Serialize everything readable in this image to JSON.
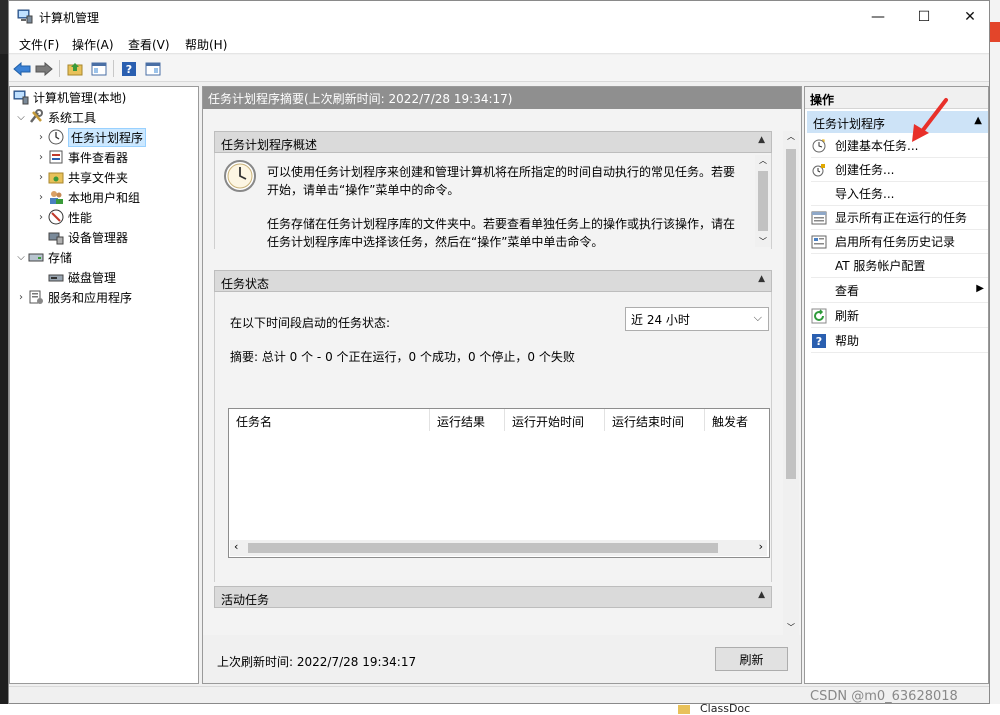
{
  "window": {
    "title": "计算机管理",
    "minimize": "—",
    "maximize": "☐",
    "close": "✕"
  },
  "menu": {
    "file": "文件(F)",
    "action": "操作(A)",
    "view": "查看(V)",
    "help": "帮助(H)"
  },
  "tree": {
    "root": "计算机管理(本地)",
    "system_tools": "系统工具",
    "task_scheduler": "任务计划程序",
    "event_viewer": "事件查看器",
    "shared_folders": "共享文件夹",
    "local_users": "本地用户和组",
    "performance": "性能",
    "device_manager": "设备管理器",
    "storage": "存储",
    "disk_management": "磁盘管理",
    "services_apps": "服务和应用程序"
  },
  "center": {
    "header": "任务计划程序摘要(上次刷新时间: 2022/7/28 19:34:17)",
    "overview": {
      "title": "任务计划程序概述",
      "p1_line1": "可以使用任务计划程序来创建和管理计算机将在所指定的时间自动执行的常见任务。若要",
      "p1_line2": "开始，请单击“操作”菜单中的命令。",
      "p2_line1": "任务存储在任务计划程序库的文件夹中。若要查看单独任务上的操作或执行该操作，请在",
      "p2_line2": "任务计划程序库中选择该任务，然后在“操作”菜单中单击命令。"
    },
    "status": {
      "title": "任务状态",
      "period_label": "在以下时间段启动的任务状态:",
      "period_value": "近 24 小时",
      "summary": "摘要: 总计 0 个 - 0 个正在运行，0 个成功，0 个停止，0 个失败",
      "columns": [
        "任务名",
        "运行结果",
        "运行开始时间",
        "运行结束时间",
        "触发者"
      ]
    },
    "active": {
      "title": "活动任务"
    },
    "footer": {
      "last_refresh": "上次刷新时间: 2022/7/28 19:34:17",
      "refresh_button": "刷新"
    }
  },
  "actions": {
    "header": "操作",
    "section": "任务计划程序",
    "items": [
      {
        "label": "创建基本任务...",
        "icon": "basic-task-icon"
      },
      {
        "label": "创建任务...",
        "icon": "create-task-icon"
      },
      {
        "label": "导入任务...",
        "icon": ""
      },
      {
        "label": "显示所有正在运行的任务",
        "icon": "running-tasks-icon"
      },
      {
        "label": "启用所有任务历史记录",
        "icon": "history-icon"
      },
      {
        "label": "AT 服务帐户配置",
        "icon": ""
      },
      {
        "label": "查看",
        "icon": ""
      },
      {
        "label": "刷新",
        "icon": "refresh-icon"
      },
      {
        "label": "帮助",
        "icon": "help-icon"
      }
    ]
  },
  "background": {
    "classdoc": "ClassDoc",
    "watermark": "CSDN @m0_63628018"
  },
  "colors": {
    "selection": "#cce8ff",
    "action_section": "#cde3f7",
    "header_gray": "#8f8f8f",
    "arrow_red": "#e8302a"
  }
}
